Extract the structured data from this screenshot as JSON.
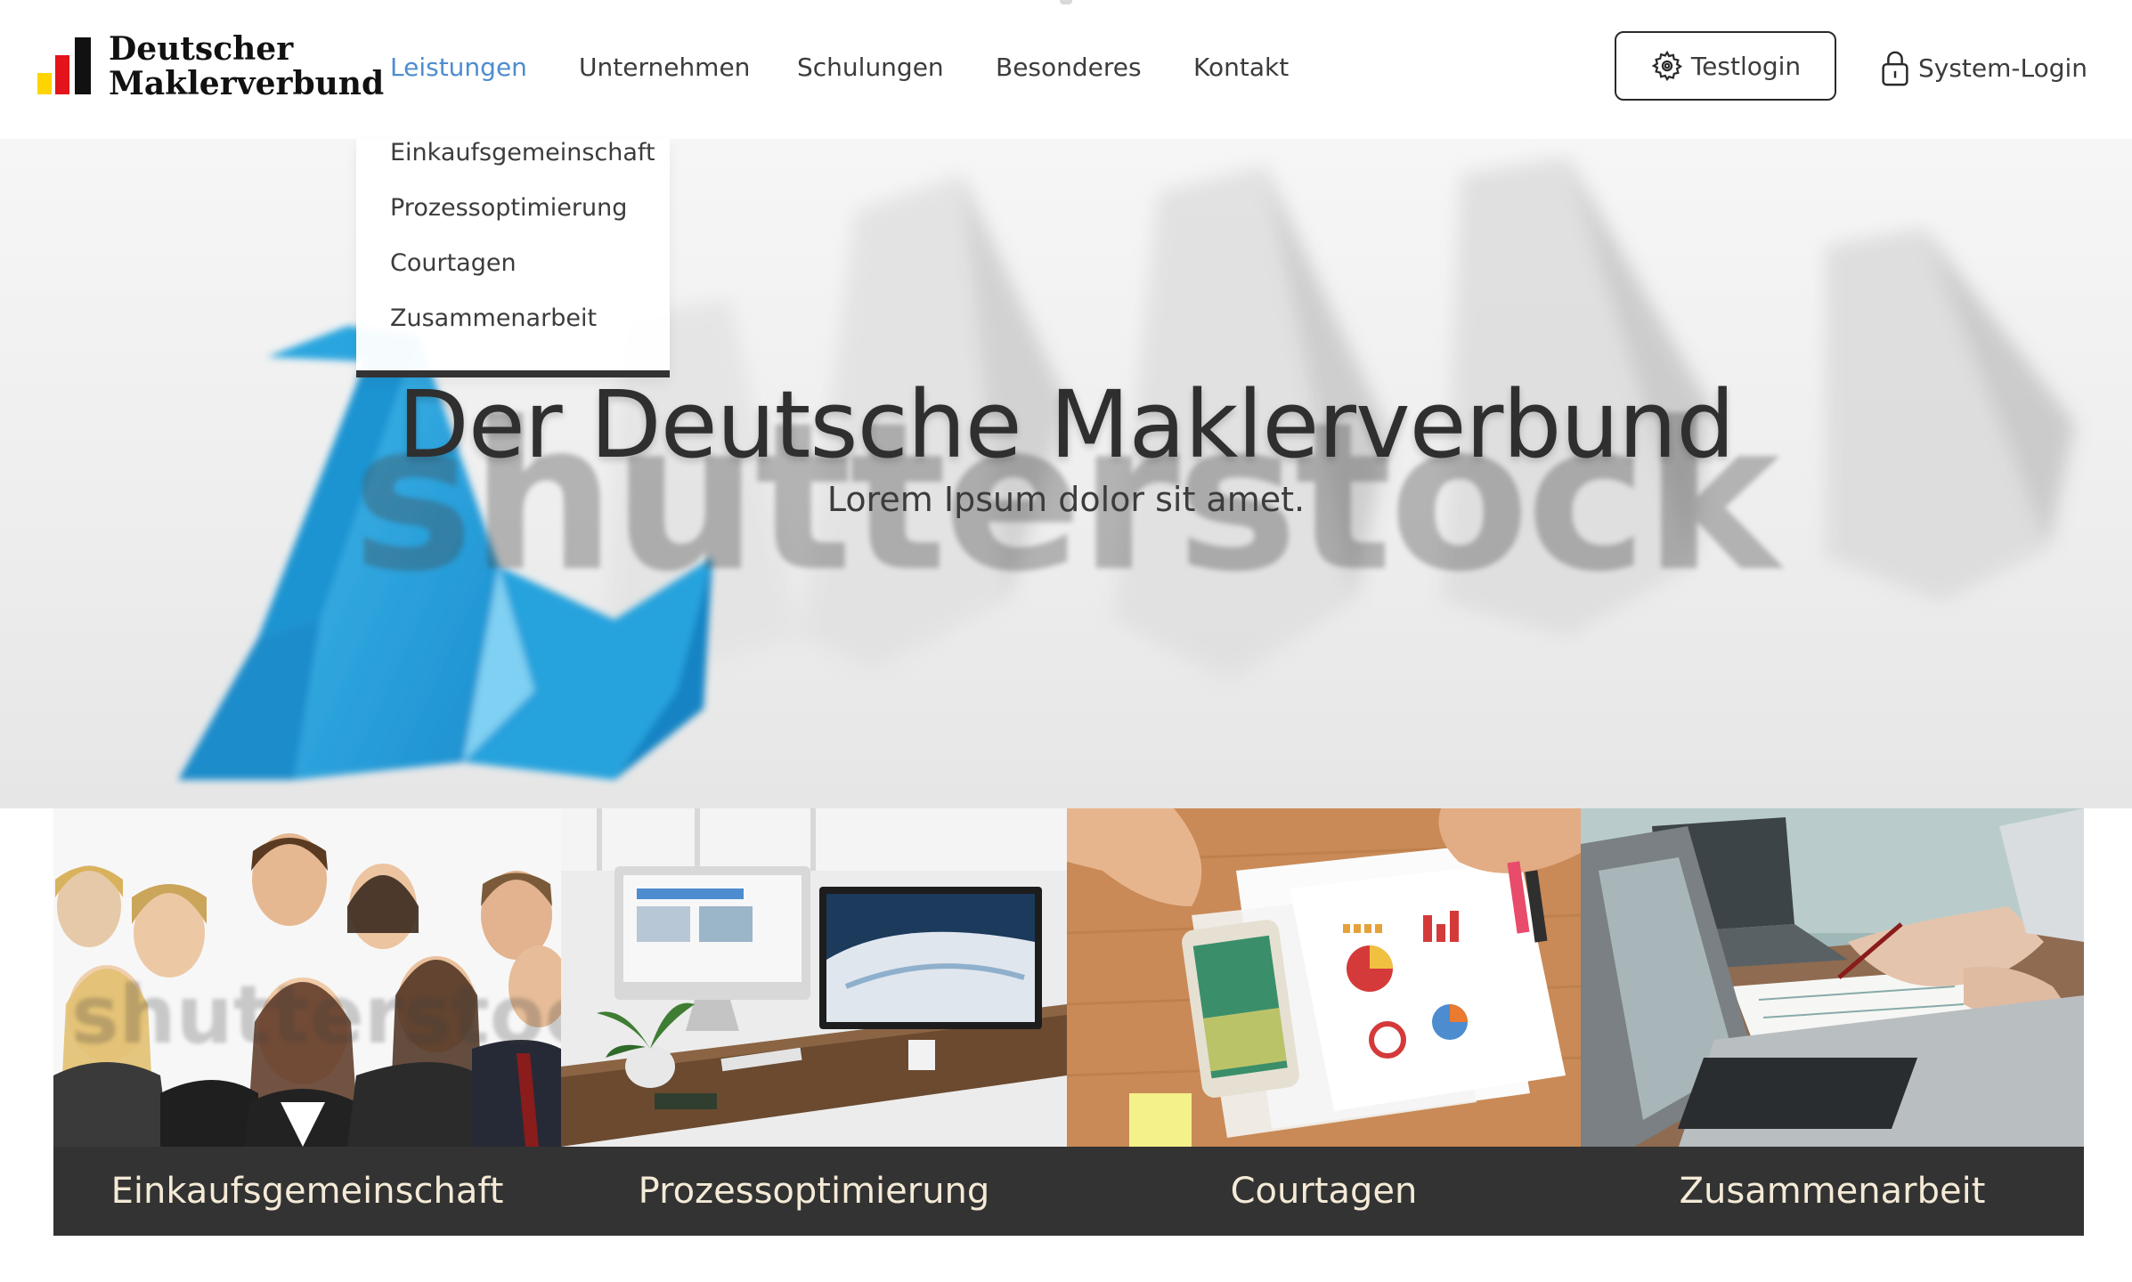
{
  "header": {
    "logo": {
      "line1": "Deutscher",
      "line2": "Maklerverbund"
    },
    "nav": [
      {
        "label": "Leistungen",
        "active": true
      },
      {
        "label": "Unternehmen",
        "active": false
      },
      {
        "label": "Schulungen",
        "active": false
      },
      {
        "label": "Besonderes",
        "active": false
      },
      {
        "label": "Kontakt",
        "active": false
      }
    ],
    "testlogin_label": "Testlogin",
    "systemlogin_label": "System-Login"
  },
  "dropdown": {
    "items": [
      "Einkaufsgemeinschaft",
      "Prozessoptimierung",
      "Courtagen",
      "Zusammenarbeit"
    ]
  },
  "hero": {
    "title": "Der Deutsche Maklerverbund",
    "subtitle": "Lorem Ipsum dolor sit amet.",
    "watermark": "shutterstock"
  },
  "cards": [
    {
      "label": "Einkaufsgemeinschaft",
      "watermark": "shutterstock"
    },
    {
      "label": "Prozessoptimierung"
    },
    {
      "label": "Courtagen"
    },
    {
      "label": "Zusammenarbeit"
    }
  ],
  "icons": {
    "testlogin": "gear-icon",
    "systemlogin": "lock-icon"
  },
  "colors": {
    "accent": "#4d8ccf",
    "caption_bg": "#333333",
    "caption_text": "#f4ead6",
    "logo_black": "#111111",
    "logo_red": "#e3141b",
    "logo_yellow": "#ffd400",
    "origami_blue": "#2ba6df"
  }
}
